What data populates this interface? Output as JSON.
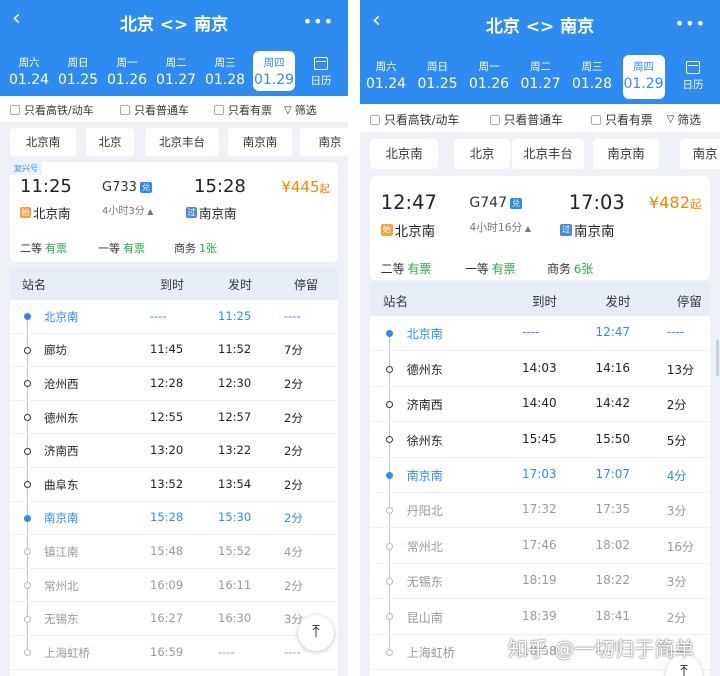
{
  "colors": {
    "header": "#2e8cf0",
    "price": "#f28a00",
    "available": "#27a84a",
    "stop_highlight": "#2e8cf0"
  },
  "panels": [
    {
      "header": {
        "back_icon": "chevron-left-icon",
        "title": "北京 <> 南京",
        "more_icon": "more-dots-icon"
      },
      "dates": [
        {
          "weekday": "周六",
          "date": "01.24"
        },
        {
          "weekday": "周日",
          "date": "01.25"
        },
        {
          "weekday": "周一",
          "date": "01.26"
        },
        {
          "weekday": "周二",
          "date": "01.27"
        },
        {
          "weekday": "周三",
          "date": "01.28"
        },
        {
          "weekday": "周四",
          "date": "01.29",
          "selected": true
        }
      ],
      "calendar_label": "日历",
      "filters": {
        "gaotie": "只看高铁/动车",
        "putong": "只看普通车",
        "youpiao": "只看有票",
        "shaixuan": "筛选"
      },
      "stations": [
        "北京南",
        "北京",
        "北京丰台",
        "南京南",
        "南京"
      ],
      "train": {
        "tag": "复兴号",
        "depart_time": "11:25",
        "train_no": "G733",
        "dui_badge": "兑",
        "duration": "4小时3分",
        "arrive_time": "15:28",
        "price": "¥445",
        "price_suffix": "起",
        "depart_station": "北京南",
        "arrive_station": "南京南",
        "depart_badge": "始",
        "arrive_badge": "过",
        "seats": [
          {
            "class": "二等",
            "status": "有票"
          },
          {
            "class": "一等",
            "status": "有票"
          },
          {
            "class": "商务",
            "status": "1张"
          }
        ]
      },
      "stop_header": {
        "station": "站名",
        "arrive": "到时",
        "depart": "发时",
        "stay": "停留"
      },
      "stops": [
        {
          "name": "北京南",
          "arrive": "----",
          "depart": "11:25",
          "stay": "----",
          "state": "blue"
        },
        {
          "name": "廊坊",
          "arrive": "11:45",
          "depart": "11:52",
          "stay": "7分",
          "state": "black"
        },
        {
          "name": "沧州西",
          "arrive": "12:28",
          "depart": "12:30",
          "stay": "2分",
          "state": "black"
        },
        {
          "name": "德州东",
          "arrive": "12:55",
          "depart": "12:57",
          "stay": "2分",
          "state": "black"
        },
        {
          "name": "济南西",
          "arrive": "13:20",
          "depart": "13:22",
          "stay": "2分",
          "state": "black"
        },
        {
          "name": "曲阜东",
          "arrive": "13:52",
          "depart": "13:54",
          "stay": "2分",
          "state": "black"
        },
        {
          "name": "南京南",
          "arrive": "15:28",
          "depart": "15:30",
          "stay": "2分",
          "state": "blue"
        },
        {
          "name": "镇江南",
          "arrive": "15:48",
          "depart": "15:52",
          "stay": "4分",
          "state": "gray"
        },
        {
          "name": "常州北",
          "arrive": "16:09",
          "depart": "16:11",
          "stay": "2分",
          "state": "gray"
        },
        {
          "name": "无锡东",
          "arrive": "16:27",
          "depart": "16:30",
          "stay": "3分",
          "state": "gray"
        },
        {
          "name": "上海虹桥",
          "arrive": "16:59",
          "depart": "----",
          "stay": "----",
          "state": "gray"
        }
      ],
      "totop_icon": "arrow-up-top-icon"
    },
    {
      "header": {
        "back_icon": "chevron-left-icon",
        "title": "北京 <> 南京",
        "more_icon": "more-dots-icon"
      },
      "dates": [
        {
          "weekday": "周六",
          "date": "01.24"
        },
        {
          "weekday": "周日",
          "date": "01.25"
        },
        {
          "weekday": "周一",
          "date": "01.26"
        },
        {
          "weekday": "周二",
          "date": "01.27"
        },
        {
          "weekday": "周三",
          "date": "01.28"
        },
        {
          "weekday": "周四",
          "date": "01.29",
          "selected": true
        }
      ],
      "calendar_label": "日历",
      "filters": {
        "gaotie": "只看高铁/动车",
        "putong": "只看普通车",
        "youpiao": "只看有票",
        "shaixuan": "筛选"
      },
      "stations": [
        "北京南",
        "北京",
        "北京丰台",
        "南京南",
        "南京"
      ],
      "train": {
        "tag": "",
        "depart_time": "12:47",
        "train_no": "G747",
        "dui_badge": "兑",
        "duration": "4小时16分",
        "arrive_time": "17:03",
        "price": "¥482",
        "price_suffix": "起",
        "depart_station": "北京南",
        "arrive_station": "南京南",
        "depart_badge": "始",
        "arrive_badge": "过",
        "seats": [
          {
            "class": "二等",
            "status": "有票"
          },
          {
            "class": "一等",
            "status": "有票"
          },
          {
            "class": "商务",
            "status": "6张"
          }
        ]
      },
      "stop_header": {
        "station": "站名",
        "arrive": "到时",
        "depart": "发时",
        "stay": "停留"
      },
      "stops": [
        {
          "name": "北京南",
          "arrive": "----",
          "depart": "12:47",
          "stay": "----",
          "state": "blue"
        },
        {
          "name": "德州东",
          "arrive": "14:03",
          "depart": "14:16",
          "stay": "13分",
          "state": "black"
        },
        {
          "name": "济南西",
          "arrive": "14:40",
          "depart": "14:42",
          "stay": "2分",
          "state": "black"
        },
        {
          "name": "徐州东",
          "arrive": "15:45",
          "depart": "15:50",
          "stay": "5分",
          "state": "black"
        },
        {
          "name": "南京南",
          "arrive": "17:03",
          "depart": "17:07",
          "stay": "4分",
          "state": "blue"
        },
        {
          "name": "丹阳北",
          "arrive": "17:32",
          "depart": "17:35",
          "stay": "3分",
          "state": "gray"
        },
        {
          "name": "常州北",
          "arrive": "17:46",
          "depart": "18:02",
          "stay": "16分",
          "state": "gray"
        },
        {
          "name": "无锡东",
          "arrive": "18:19",
          "depart": "18:22",
          "stay": "3分",
          "state": "gray"
        },
        {
          "name": "昆山南",
          "arrive": "18:39",
          "depart": "18:41",
          "stay": "2分",
          "state": "gray"
        },
        {
          "name": "上海虹桥",
          "arrive": "18:58",
          "depart": "----",
          "stay": "----",
          "state": "gray"
        }
      ],
      "totop_icon": "arrow-up-top-icon",
      "watermark": "知乎 @一切归于简单"
    }
  ]
}
